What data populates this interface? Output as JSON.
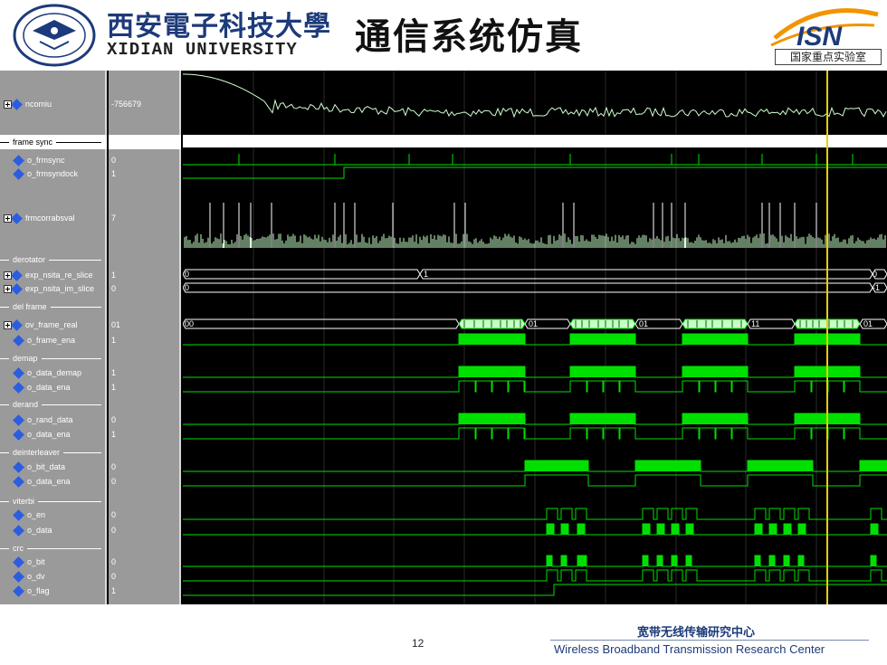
{
  "header": {
    "university_cn": "西安電子科技大學",
    "university_en": "XIDIAN UNIVERSITY",
    "title": "通信系统仿真",
    "logo_text": "ISN",
    "lab_label": "国家重点实验室"
  },
  "signals": [
    {
      "kind": "signal",
      "expand": true,
      "indent": false,
      "name": "ncomiu",
      "value": "-756679"
    },
    {
      "kind": "divider",
      "name": "frame sync",
      "highlight": true
    },
    {
      "kind": "signal",
      "expand": false,
      "indent": true,
      "name": "o_frmsync",
      "value": "0"
    },
    {
      "kind": "signal",
      "expand": false,
      "indent": true,
      "name": "o_frmsyndock",
      "value": "1"
    },
    {
      "kind": "signal",
      "expand": true,
      "indent": false,
      "name": "frmcorrabsval",
      "value": "7"
    },
    {
      "kind": "divider",
      "name": "derotator"
    },
    {
      "kind": "signal",
      "expand": true,
      "indent": false,
      "name": "exp_nsita_re_slice",
      "value": "1"
    },
    {
      "kind": "signal",
      "expand": true,
      "indent": false,
      "name": "exp_nsita_im_slice",
      "value": "0"
    },
    {
      "kind": "divider",
      "name": "del frame"
    },
    {
      "kind": "signal",
      "expand": true,
      "indent": false,
      "name": "ov_frame_real",
      "value": "01"
    },
    {
      "kind": "signal",
      "expand": false,
      "indent": true,
      "name": "o_frame_ena",
      "value": "1"
    },
    {
      "kind": "divider",
      "name": "demap"
    },
    {
      "kind": "signal",
      "expand": false,
      "indent": true,
      "name": "o_data_demap",
      "value": "1"
    },
    {
      "kind": "signal",
      "expand": false,
      "indent": true,
      "name": "o_data_ena",
      "value": "1"
    },
    {
      "kind": "divider",
      "name": "derand"
    },
    {
      "kind": "signal",
      "expand": false,
      "indent": true,
      "name": "o_rand_data",
      "value": "0"
    },
    {
      "kind": "signal",
      "expand": false,
      "indent": true,
      "name": "o_data_ena",
      "value": "1"
    },
    {
      "kind": "divider",
      "name": "deinterleaver"
    },
    {
      "kind": "signal",
      "expand": false,
      "indent": true,
      "name": "o_bit_data",
      "value": "0"
    },
    {
      "kind": "signal",
      "expand": false,
      "indent": true,
      "name": "o_data_ena",
      "value": "0"
    },
    {
      "kind": "divider",
      "name": "viterbi"
    },
    {
      "kind": "signal",
      "expand": false,
      "indent": true,
      "name": "o_en",
      "value": "0"
    },
    {
      "kind": "signal",
      "expand": false,
      "indent": true,
      "name": "o_data",
      "value": "0"
    },
    {
      "kind": "divider",
      "name": "crc"
    },
    {
      "kind": "signal",
      "expand": false,
      "indent": true,
      "name": "o_bit",
      "value": "0"
    },
    {
      "kind": "signal",
      "expand": false,
      "indent": true,
      "name": "o_dv",
      "value": "0"
    },
    {
      "kind": "signal",
      "expand": false,
      "indent": true,
      "name": "o_flag",
      "value": "1"
    }
  ],
  "bus_labels": {
    "exp_re": [
      "0",
      "1",
      "0"
    ],
    "exp_im": [
      "0",
      "-1"
    ],
    "ov_frame": [
      "00",
      "01",
      "01",
      "11",
      "01"
    ]
  },
  "colors": {
    "wave": "#00e000",
    "bus_fill": "#c8ffc8",
    "cursor": "#e8d000",
    "grid": "#2a2a2a",
    "title_blue": "#1d3a7a"
  },
  "footer": {
    "page": "12",
    "center_cn": "宽带无线传输研究中心",
    "center_en": "Wireless Broadband Transmission Research Center"
  }
}
